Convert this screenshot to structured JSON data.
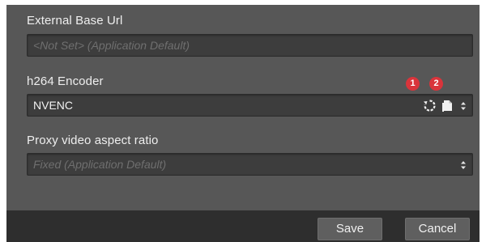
{
  "fields": [
    {
      "label": "External Base Url",
      "placeholder": "<Not Set> (Application Default)"
    },
    {
      "label": "h264 Encoder",
      "value": "NVENC",
      "icons": [
        "reset-icon",
        "copy-icon",
        "dropdown-arrow-icon"
      ]
    },
    {
      "label": "Proxy video aspect ratio",
      "placeholder": "Fixed (Application Default)",
      "icons": [
        "dropdown-arrow-icon"
      ]
    }
  ],
  "badges": [
    "1",
    "2"
  ],
  "buttons": {
    "save_label": "Save",
    "cancel_label": "Cancel"
  },
  "colors": {
    "dialog_bg": "#575757",
    "footer_bg": "#2e2e2e",
    "badge": "#d9343b"
  }
}
